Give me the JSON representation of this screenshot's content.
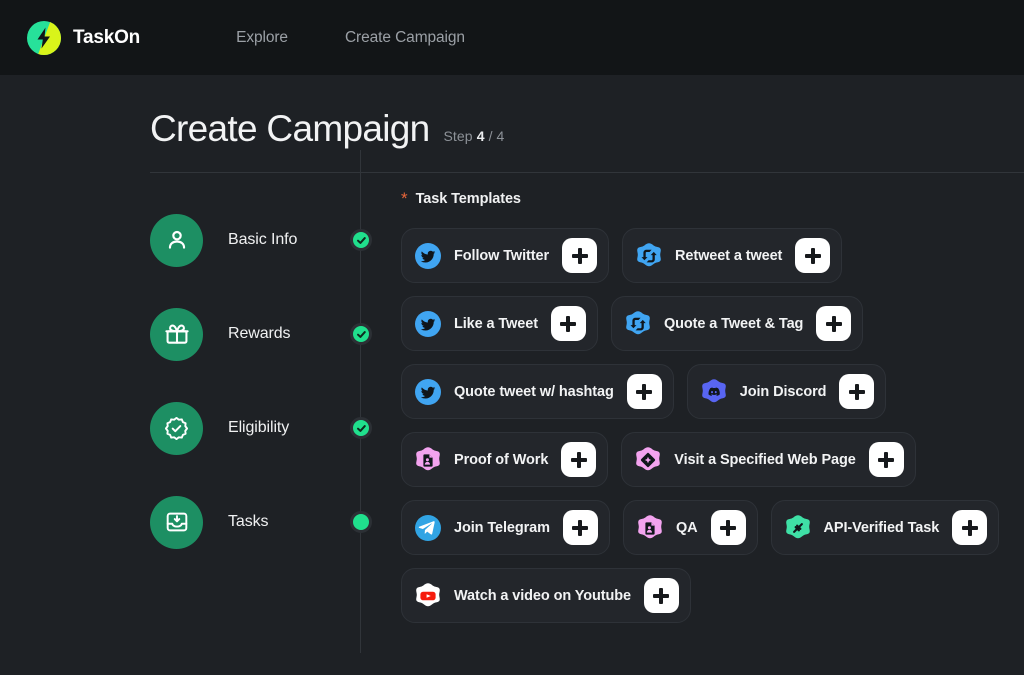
{
  "nav": {
    "brand": "TaskOn",
    "logo_icon": "taskon-bolt-logo",
    "links": [
      {
        "label": "Explore",
        "name": "nav-link-explore"
      },
      {
        "label": "Create Campaign",
        "name": "nav-link-create-campaign"
      }
    ]
  },
  "page": {
    "title": "Create Campaign",
    "step_word": "Step",
    "step_current": "4",
    "step_total": "/ 4"
  },
  "stepper": {
    "steps": [
      {
        "label": "Basic Info",
        "icon": "user-icon",
        "state": "complete"
      },
      {
        "label": "Rewards",
        "icon": "gift-icon",
        "state": "complete"
      },
      {
        "label": "Eligibility",
        "icon": "badge-check-icon",
        "state": "complete"
      },
      {
        "label": "Tasks",
        "icon": "inbox-icon",
        "state": "current"
      }
    ]
  },
  "templates": {
    "required_marker": "*",
    "title": "Task Templates",
    "add_label": "+",
    "rows": [
      [
        {
          "label": "Follow Twitter",
          "icon": "twitter-icon"
        },
        {
          "label": "Retweet a tweet",
          "icon": "retweet-icon"
        }
      ],
      [
        {
          "label": "Like a Tweet",
          "icon": "twitter-icon"
        },
        {
          "label": "Quote a Tweet & Tag",
          "icon": "retweet-icon"
        }
      ],
      [
        {
          "label": "Quote tweet w/ hashtag",
          "icon": "twitter-icon"
        },
        {
          "label": "Join Discord",
          "icon": "discord-icon"
        }
      ],
      [
        {
          "label": "Proof of Work",
          "icon": "document-icon"
        },
        {
          "label": "Visit a Specified Web Page",
          "icon": "compass-icon"
        }
      ],
      [
        {
          "label": "Join Telegram",
          "icon": "telegram-icon"
        },
        {
          "label": "QA",
          "icon": "document-icon"
        },
        {
          "label": "API-Verified Task",
          "icon": "plug-icon"
        }
      ],
      [
        {
          "label": "Watch a video on Youtube",
          "icon": "youtube-icon"
        }
      ]
    ]
  },
  "colors": {
    "header_bg": "#121517",
    "page_bg": "#1e2125",
    "chip_bg": "#23262b",
    "accent_green": "#20e08d",
    "step_circle": "#1d8f63",
    "required_star": "#e8663a",
    "twitter_blue": "#40a5f2",
    "discord_purple": "#5865f2",
    "telegram_blue": "#31a4e4",
    "pink": "#f3a3ef",
    "mint": "#3fe0a6",
    "youtube_red": "#f61c0d"
  }
}
